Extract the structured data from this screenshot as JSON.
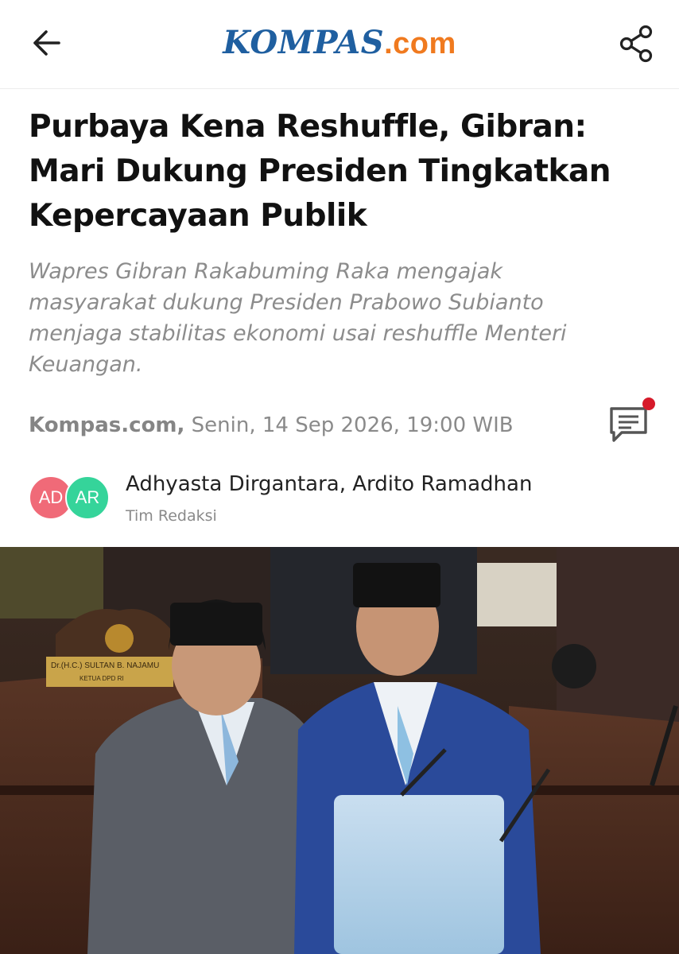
{
  "header": {
    "logo_main": "KOMPAS",
    "logo_suffix": ".com",
    "back_icon": "arrow-left-icon",
    "share_icon": "share-icon"
  },
  "article": {
    "headline": "Purbaya Kena Reshuffle, Gibran: Mari Dukung Presiden Tingkatkan Kepercayaan Publik",
    "lead": "Wapres Gibran Rakabuming Raka mengajak masyarakat dukung Presiden Prabowo Subianto menjaga stabilitas ekonomi usai reshuffle Menteri Keuangan.",
    "source": "Kompas.com,",
    "datetime": "Senin, 14 Sep 2026, 19:00 WIB",
    "comment_icon": "comment-icon",
    "has_notification": true
  },
  "authors": {
    "initials": [
      "AD",
      "AR"
    ],
    "names": "Adhyasta Dirgantara, Ardito Ramadhan",
    "team_label": "Tim Redaksi"
  },
  "photo": {
    "placard_text": "Dr.(H.C.) SULTAN B. NAJAMU",
    "placard_subtext": "KETUA DPD RI"
  },
  "colors": {
    "brand_blue": "#1f5fa0",
    "brand_orange": "#f07a1f",
    "notification_red": "#d61a2a",
    "avatar_1": "#f06a78",
    "avatar_2": "#35d49a"
  }
}
